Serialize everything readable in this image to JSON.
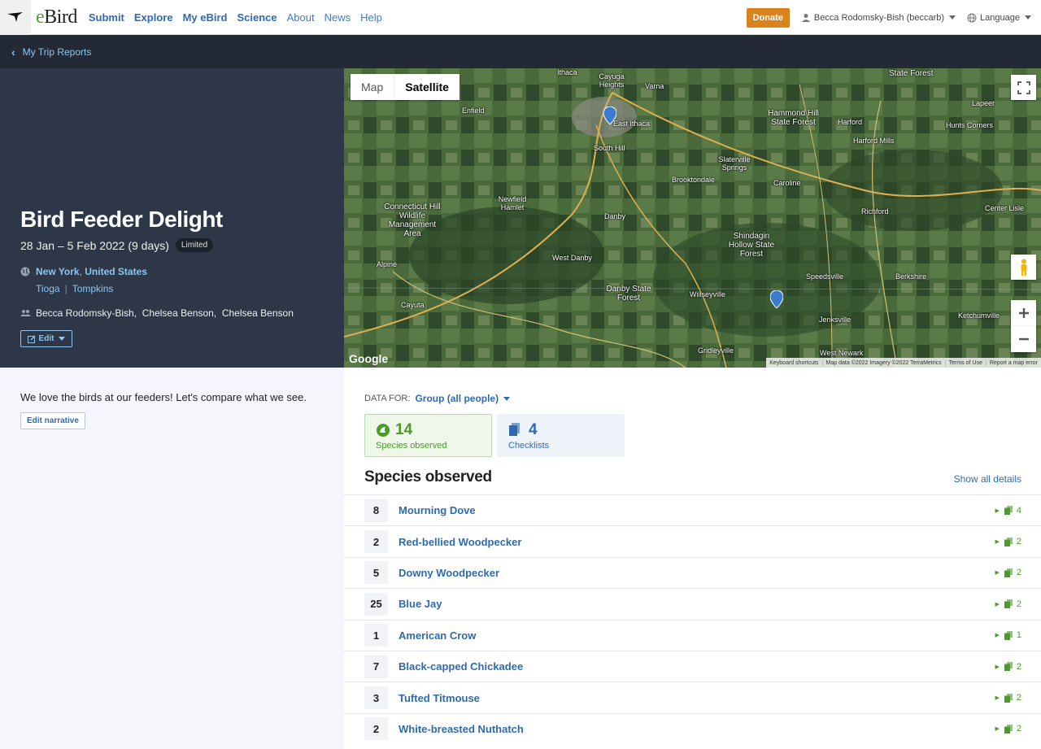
{
  "nav": {
    "brand_e": "e",
    "brand_rest": "Bird",
    "links": [
      {
        "label": "Submit",
        "style": "bold"
      },
      {
        "label": "Explore",
        "style": "bold"
      },
      {
        "label": "My eBird",
        "style": "bold"
      },
      {
        "label": "Science",
        "style": "bold"
      },
      {
        "label": "About",
        "style": "light"
      },
      {
        "label": "News",
        "style": "light"
      },
      {
        "label": "Help",
        "style": "light"
      }
    ],
    "donate": "Donate",
    "user": "Becca Rodomsky-Bish (beccarb)",
    "language": "Language"
  },
  "breadcrumb": {
    "back_label": "My Trip Reports"
  },
  "trip": {
    "title": "Bird Feeder Delight",
    "dates": "28 Jan – 5 Feb 2022 (9 days)",
    "badge": "Limited",
    "state": "New York",
    "country": "United States",
    "counties": [
      "Tioga",
      "Tompkins"
    ],
    "people": [
      "Becca Rodomsky-Bish",
      "Chelsea Benson",
      "Chelsea Benson"
    ],
    "edit_label": "Edit",
    "narrative": "We love the birds at our feeders! Let's compare what we see.",
    "edit_narrative": "Edit narrative"
  },
  "map": {
    "type_map": "Map",
    "type_satellite": "Satellite",
    "google": "Google",
    "footer": [
      "Keyboard shortcuts",
      "Map data ©2022 Imagery ©2022 TerraMetrics",
      "Terms of Use",
      "Report a map error"
    ],
    "labels": [
      "Ithaca",
      "Cayuga Heights",
      "Varna",
      "Enfield",
      "East Ithaca",
      "South Hill",
      "Hammond Hill State Forest",
      "Harford",
      "Harford Mills",
      "Hunts Corners",
      "Lapeer",
      "Slaterville Springs",
      "Brooktondale",
      "Caroline",
      "Connecticut Hill Wildlife Management Area",
      "Newfield Hamlet",
      "Danby",
      "Richford",
      "Center Lisle",
      "Shindagin Hollow State Forest",
      "Alpine",
      "West Danby",
      "Speedsville",
      "Berkshire",
      "Danby State Forest",
      "Willseyville",
      "Cayuta",
      "Jenksville",
      "Ketchumville",
      "Gridleyville",
      "West Newark",
      "State Forest"
    ]
  },
  "data_for": {
    "label": "DATA FOR:",
    "value": "Group (all people)"
  },
  "stats": {
    "species_count": "14",
    "species_label": "Species observed",
    "checklists_count": "4",
    "checklists_label": "Checklists"
  },
  "species_section": {
    "title": "Species observed",
    "show_all": "Show all details"
  },
  "species": [
    {
      "count": "8",
      "name": "Mourning Dove",
      "checklists": "4"
    },
    {
      "count": "2",
      "name": "Red-bellied Woodpecker",
      "checklists": "2"
    },
    {
      "count": "5",
      "name": "Downy Woodpecker",
      "checklists": "2"
    },
    {
      "count": "25",
      "name": "Blue Jay",
      "checklists": "2"
    },
    {
      "count": "1",
      "name": "American Crow",
      "checklists": "1"
    },
    {
      "count": "7",
      "name": "Black-capped Chickadee",
      "checklists": "2"
    },
    {
      "count": "3",
      "name": "Tufted Titmouse",
      "checklists": "2"
    },
    {
      "count": "2",
      "name": "White-breasted Nuthatch",
      "checklists": "2"
    }
  ],
  "colors": {
    "accent": "#2f6aad",
    "green": "#4b9a2a",
    "donate": "#d9831f",
    "hero": "#2d3748"
  }
}
